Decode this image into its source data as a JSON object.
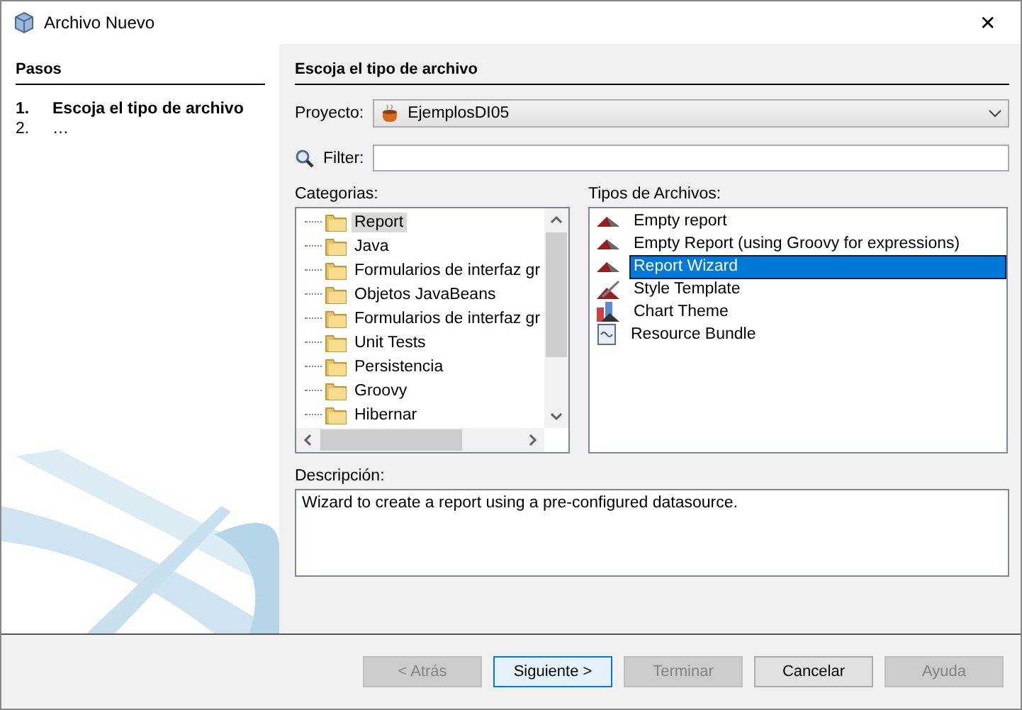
{
  "window": {
    "title": "Archivo Nuevo",
    "close": "✕"
  },
  "steps": {
    "title": "Pasos",
    "items": [
      {
        "number": "1.",
        "label": "Escoja el tipo de archivo",
        "selected": true
      },
      {
        "number": "2.",
        "label": "…",
        "selected": false
      }
    ]
  },
  "panel": {
    "title": "Escoja el tipo de archivo",
    "project": {
      "label": "Proyecto:",
      "value": "EjemplosDI05"
    },
    "filter": {
      "label": "Filter:"
    },
    "categories": {
      "label": "Categorias:",
      "items": [
        {
          "label": "Report",
          "selected": true
        },
        {
          "label": "Java",
          "selected": false
        },
        {
          "label": "Formularios de interfaz gr",
          "selected": false
        },
        {
          "label": "Objetos JavaBeans",
          "selected": false
        },
        {
          "label": "Formularios de interfaz gr",
          "selected": false
        },
        {
          "label": "Unit Tests",
          "selected": false
        },
        {
          "label": "Persistencia",
          "selected": false
        },
        {
          "label": "Groovy",
          "selected": false
        },
        {
          "label": "Hibernar",
          "selected": false
        }
      ]
    },
    "file_types": {
      "label": "Tipos de Archivos:",
      "items": [
        {
          "label": "Empty report",
          "kind": "report",
          "selected": false
        },
        {
          "label": "Empty Report (using Groovy for expressions)",
          "kind": "report",
          "selected": false
        },
        {
          "label": "Report Wizard",
          "kind": "report",
          "selected": true
        },
        {
          "label": "Style Template",
          "kind": "style",
          "selected": false
        },
        {
          "label": "Chart Theme",
          "kind": "chart",
          "selected": false
        },
        {
          "label": "Resource Bundle",
          "kind": "bundle",
          "selected": false
        }
      ]
    },
    "description": {
      "label": "Descripción:",
      "text": "Wizard to create a report using a pre-configured datasource."
    }
  },
  "buttons": [
    {
      "label": "< Atrás",
      "disabled": true,
      "default": false
    },
    {
      "label": "Siguiente >",
      "disabled": false,
      "default": true
    },
    {
      "label": "Terminar",
      "disabled": true,
      "default": false
    },
    {
      "label": "Cancelar",
      "disabled": false,
      "default": false
    },
    {
      "label": "Ayuda",
      "disabled": true,
      "default": false
    }
  ]
}
